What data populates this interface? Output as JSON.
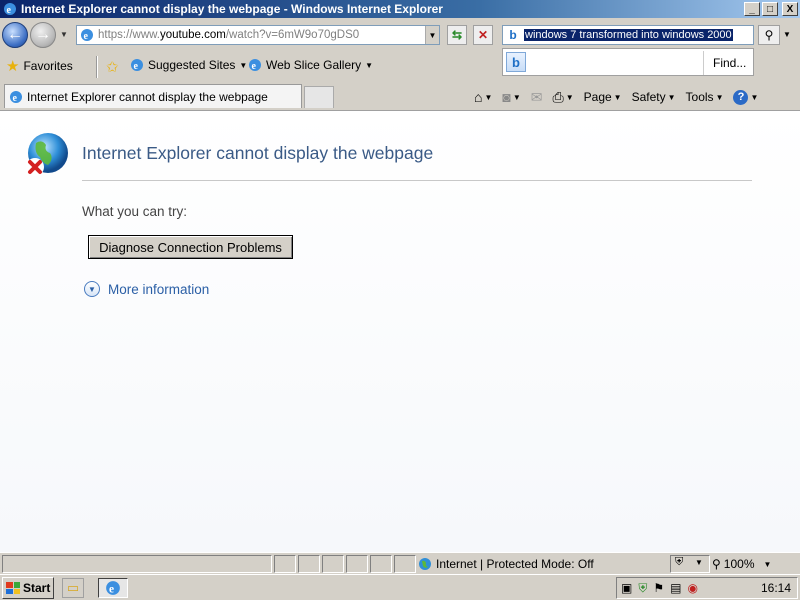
{
  "window": {
    "title": "Internet Explorer cannot display the webpage - Windows Internet Explorer",
    "minimize_label": "_",
    "maximize_label": "□",
    "close_label": "X"
  },
  "address": {
    "url_prefix": "https://www.",
    "url_domain": "youtube.com",
    "url_path": "/watch?v=6mW9o70gDS0"
  },
  "search": {
    "query": "windows 7 transformed into windows 2000",
    "find_label": "Find..."
  },
  "favorites": {
    "favorites_label": "Favorites",
    "items": [
      {
        "label": "Suggested Sites"
      },
      {
        "label": "Web Slice Gallery"
      }
    ]
  },
  "tabs": [
    {
      "label": "Internet Explorer cannot display the webpage"
    }
  ],
  "command_bar": {
    "page_label": "Page",
    "safety_label": "Safety",
    "tools_label": "Tools"
  },
  "error_page": {
    "title": "Internet Explorer cannot display the webpage",
    "try_text": "What you can try:",
    "diagnose_button": "Diagnose Connection Problems",
    "more_info": "More information"
  },
  "status_bar": {
    "zone": "Internet | Protected Mode: Off",
    "zoom": "100%"
  },
  "taskbar": {
    "start_label": "Start",
    "clock": "16:14"
  },
  "colors": {
    "title_bar": "#0a246a",
    "link_blue": "#2b5fa6",
    "error_title": "#3a5a86"
  }
}
